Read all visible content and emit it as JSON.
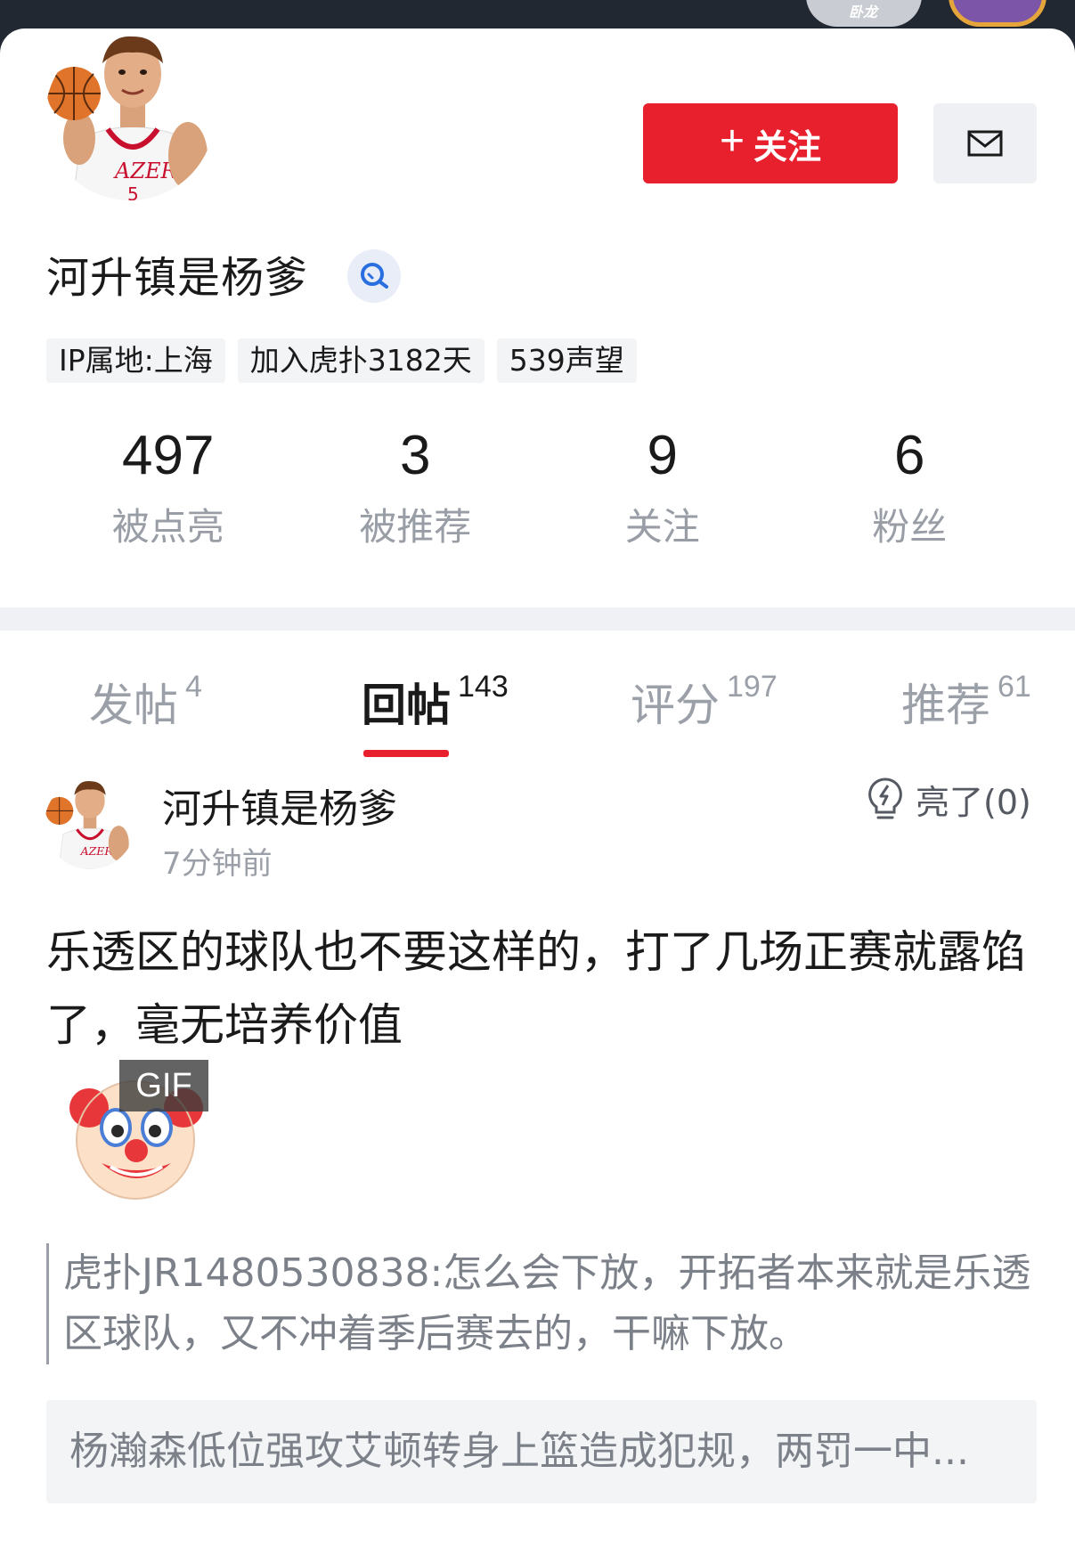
{
  "profile": {
    "username": "河升镇是杨爹",
    "follow_label": "关注",
    "tags": [
      "IP属地:上海",
      "加入虎扑3182天",
      "539声望"
    ]
  },
  "stats": [
    {
      "value": "497",
      "label": "被点亮"
    },
    {
      "value": "3",
      "label": "被推荐"
    },
    {
      "value": "9",
      "label": "关注"
    },
    {
      "value": "6",
      "label": "粉丝"
    }
  ],
  "tabs": [
    {
      "label": "发帖",
      "count": "4"
    },
    {
      "label": "回帖",
      "count": "143",
      "active": true
    },
    {
      "label": "评分",
      "count": "197"
    },
    {
      "label": "推荐",
      "count": "61"
    }
  ],
  "post": {
    "author": "河升镇是杨爹",
    "time": "7分钟前",
    "light_label": "亮了(0)",
    "content": "乐透区的球队也不要这样的，打了几场正赛就露馅了，毫无培养价值",
    "gif_badge": "GIF",
    "quote": "虎扑JR1480530838:怎么会下放，开拓者本来就是乐透区球队，又不冲着季后赛去的，干嘛下放。",
    "reference": "杨瀚森低位强攻艾顿转身上篮造成犯规，两罚一中..."
  },
  "colors": {
    "accent": "#e8202e",
    "muted": "#9ba0a8",
    "tag_bg": "#f3f4f6"
  },
  "icons": {
    "follow": "plus-icon",
    "message": "mail-icon",
    "verify": "search-verified-icon",
    "light": "lightbulb-icon",
    "gif": "clown-emoji"
  }
}
